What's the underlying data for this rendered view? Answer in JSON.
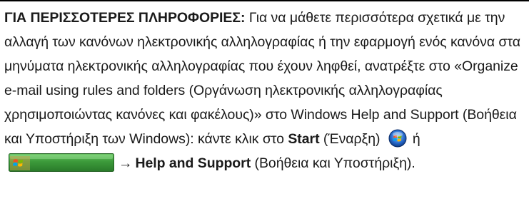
{
  "note": {
    "label": "ΓΙΑ ΠΕΡΙΣΣΟΤΕΡΕΣ ΠΛΗΡΟΦΟΡΙΕΣ:",
    "body_text": " Για να μάθετε περισσότερα σχετικά με την αλλαγή των κανόνων ηλεκτρονικής αλληλογραφίας ή την εφαρμογή ενός κανόνα στα μηνύματα ηλεκτρονικής αλληλογραφίας που έχουν ληφθεί, ανατρέξτε στο «Organize e-mail using rules and folders (Οργάνωση ηλεκτρονικής αλληλογραφίας χρησιμοποιώντας κανόνες και φακέλους)» στο Windows Help and Support (Βοήθεια και Υποστήριξη των Windows): κάντε κλικ στο ",
    "start_label": "Start",
    "start_translation": " (Έναρξη)",
    "or_text": "ή",
    "arrow": "→",
    "help_label": "Help and Support",
    "help_translation": " (Βοήθεια και Υποστήριξη)."
  },
  "icons": {
    "start_orb": "windows-vista-start-orb-icon",
    "start_bar": "windows-xp-start-button-icon"
  },
  "colors": {
    "rule": "#000000",
    "text": "#1a1a1a",
    "start_bar_green": "#3c9a3a",
    "orb_blue": "#2b6fd1"
  }
}
